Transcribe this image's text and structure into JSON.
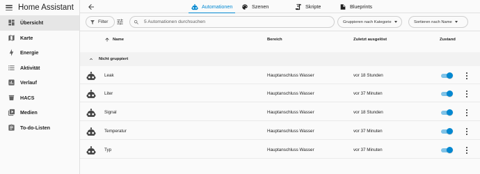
{
  "sidebar": {
    "title": "Home Assistant",
    "items": [
      {
        "label": "Übersicht",
        "icon": "view-dashboard-icon"
      },
      {
        "label": "Karte",
        "icon": "map-icon"
      },
      {
        "label": "Energie",
        "icon": "lightning-bolt-icon"
      },
      {
        "label": "Aktivität",
        "icon": "format-list-bulleted-icon"
      },
      {
        "label": "Verlauf",
        "icon": "chart-box-icon"
      },
      {
        "label": "HACS",
        "icon": "hacs-icon"
      },
      {
        "label": "Medien",
        "icon": "play-box-multiple-icon"
      },
      {
        "label": "To-do-Listen",
        "icon": "clipboard-list-icon"
      }
    ]
  },
  "tabs": [
    {
      "label": "Automationen",
      "icon": "robot-icon",
      "active": true
    },
    {
      "label": "Szenen",
      "icon": "palette-icon",
      "active": false
    },
    {
      "label": "Skripte",
      "icon": "script-text-icon",
      "active": false
    },
    {
      "label": "Blueprints",
      "icon": "paper-outline-icon",
      "active": false
    }
  ],
  "toolbar": {
    "filter_label": "Filter",
    "search_placeholder": "5 Automationen durchsuchen",
    "group_label": "Gruppieren nach Kategorie",
    "sort_label": "Sortieren nach Name"
  },
  "table": {
    "columns": {
      "name": "Name",
      "area": "Bereich",
      "last_triggered": "Zuletzt ausgelöst",
      "state": "Zustand"
    },
    "group_label": "Nicht gruppiert",
    "rows": [
      {
        "name": "Leak",
        "area": "Hauptanschluss Wasser",
        "last_triggered": "vor 18 Stunden",
        "enabled": true
      },
      {
        "name": "Liter",
        "area": "Hauptanschluss Wasser",
        "last_triggered": "vor 37 Minuten",
        "enabled": true
      },
      {
        "name": "Signal",
        "area": "Hauptanschluss Wasser",
        "last_triggered": "vor 18 Stunden",
        "enabled": true
      },
      {
        "name": "Temperatur",
        "area": "Hauptanschluss Wasser",
        "last_triggered": "vor 37 Minuten",
        "enabled": true
      },
      {
        "name": "Typ",
        "area": "Hauptanschluss Wasser",
        "last_triggered": "vor 37 Minuten",
        "enabled": true
      }
    ]
  },
  "colors": {
    "accent": "#0288d1",
    "toggle_track": "#7fc3e8"
  }
}
